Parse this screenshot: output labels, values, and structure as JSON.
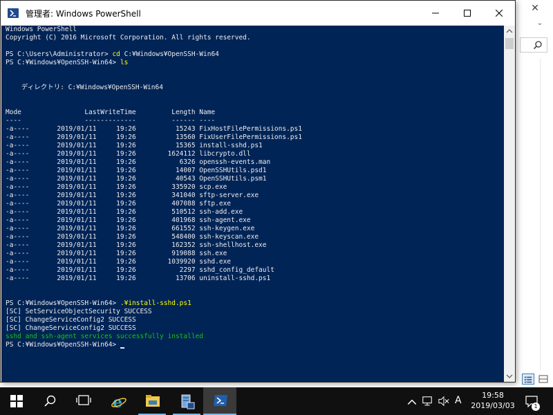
{
  "window": {
    "title": "管理者: Windows PowerShell"
  },
  "console": {
    "lines": [
      {
        "text": "Windows PowerShell",
        "style": "white"
      },
      {
        "text": "Copyright (C) 2016 Microsoft Corporation. All rights reserved.",
        "style": "white"
      },
      {
        "text": "",
        "style": "white"
      },
      {
        "prompt": "PS C:\\Users\\Administrator> ",
        "cmd": "cd",
        "arg": " C:¥Windows¥OpenSSH-Win64"
      },
      {
        "prompt": "PS C:¥Windows¥OpenSSH-Win64> ",
        "cmd": "ls",
        "arg": ""
      },
      {
        "text": "",
        "style": "white"
      },
      {
        "text": "",
        "style": "white"
      },
      {
        "text": "    ディレクトリ: C:¥Windows¥OpenSSH-Win64",
        "style": "white"
      },
      {
        "text": "",
        "style": "white"
      },
      {
        "text": "",
        "style": "white"
      },
      {
        "text": "Mode                LastWriteTime         Length Name",
        "style": "white"
      },
      {
        "text": "----                -------------         ------ ----",
        "style": "white"
      },
      {
        "text": "-a----       2019/01/11     19:26          15243 FixHostFilePermissions.ps1",
        "style": "white"
      },
      {
        "text": "-a----       2019/01/11     19:26          13560 FixUserFilePermissions.ps1",
        "style": "white"
      },
      {
        "text": "-a----       2019/01/11     19:26          15365 install-sshd.ps1",
        "style": "white"
      },
      {
        "text": "-a----       2019/01/11     19:26        1624112 libcrypto.dll",
        "style": "white"
      },
      {
        "text": "-a----       2019/01/11     19:26           6326 openssh-events.man",
        "style": "white"
      },
      {
        "text": "-a----       2019/01/11     19:26          14007 OpenSSHUtils.psd1",
        "style": "white"
      },
      {
        "text": "-a----       2019/01/11     19:26          40543 OpenSSHUtils.psm1",
        "style": "white"
      },
      {
        "text": "-a----       2019/01/11     19:26         335920 scp.exe",
        "style": "white"
      },
      {
        "text": "-a----       2019/01/11     19:26         341040 sftp-server.exe",
        "style": "white"
      },
      {
        "text": "-a----       2019/01/11     19:26         407088 sftp.exe",
        "style": "white"
      },
      {
        "text": "-a----       2019/01/11     19:26         510512 ssh-add.exe",
        "style": "white"
      },
      {
        "text": "-a----       2019/01/11     19:26         401968 ssh-agent.exe",
        "style": "white"
      },
      {
        "text": "-a----       2019/01/11     19:26         661552 ssh-keygen.exe",
        "style": "white"
      },
      {
        "text": "-a----       2019/01/11     19:26         548400 ssh-keyscan.exe",
        "style": "white"
      },
      {
        "text": "-a----       2019/01/11     19:26         162352 ssh-shellhost.exe",
        "style": "white"
      },
      {
        "text": "-a----       2019/01/11     19:26         919088 ssh.exe",
        "style": "white"
      },
      {
        "text": "-a----       2019/01/11     19:26        1039920 sshd.exe",
        "style": "white"
      },
      {
        "text": "-a----       2019/01/11     19:26           2297 sshd_config_default",
        "style": "white"
      },
      {
        "text": "-a----       2019/01/11     19:26          13706 uninstall-sshd.ps1",
        "style": "white"
      },
      {
        "text": "",
        "style": "white"
      },
      {
        "text": "",
        "style": "white"
      },
      {
        "prompt": "PS C:¥Windows¥OpenSSH-Win64> ",
        "cmd": ".¥install-sshd.ps1",
        "arg": ""
      },
      {
        "text": "[SC] SetServiceObjectSecurity SUCCESS",
        "style": "white"
      },
      {
        "text": "[SC] ChangeServiceConfig2 SUCCESS",
        "style": "white"
      },
      {
        "text": "[SC] ChangeServiceConfig2 SUCCESS",
        "style": "white"
      },
      {
        "text": "sshd and ssh-agent services successfully installed",
        "style": "green"
      },
      {
        "prompt": "PS C:¥Windows¥OpenSSH-Win64> ",
        "cmd": "",
        "arg": "",
        "cursor": true
      }
    ]
  },
  "taskbar": {
    "items": [
      "start",
      "search",
      "task-view",
      "internet-explorer",
      "file-explorer",
      "server-manager",
      "powershell"
    ],
    "ime_indicator": "A",
    "clock_time": "19:58",
    "clock_date": "2019/03/03",
    "notification_count": "1"
  },
  "colors": {
    "console_bg": "#012456",
    "console_text": "#eeedf0",
    "command_highlight": "#ffff00",
    "success_text": "#16c60c",
    "taskbar_bg": "#101010"
  }
}
